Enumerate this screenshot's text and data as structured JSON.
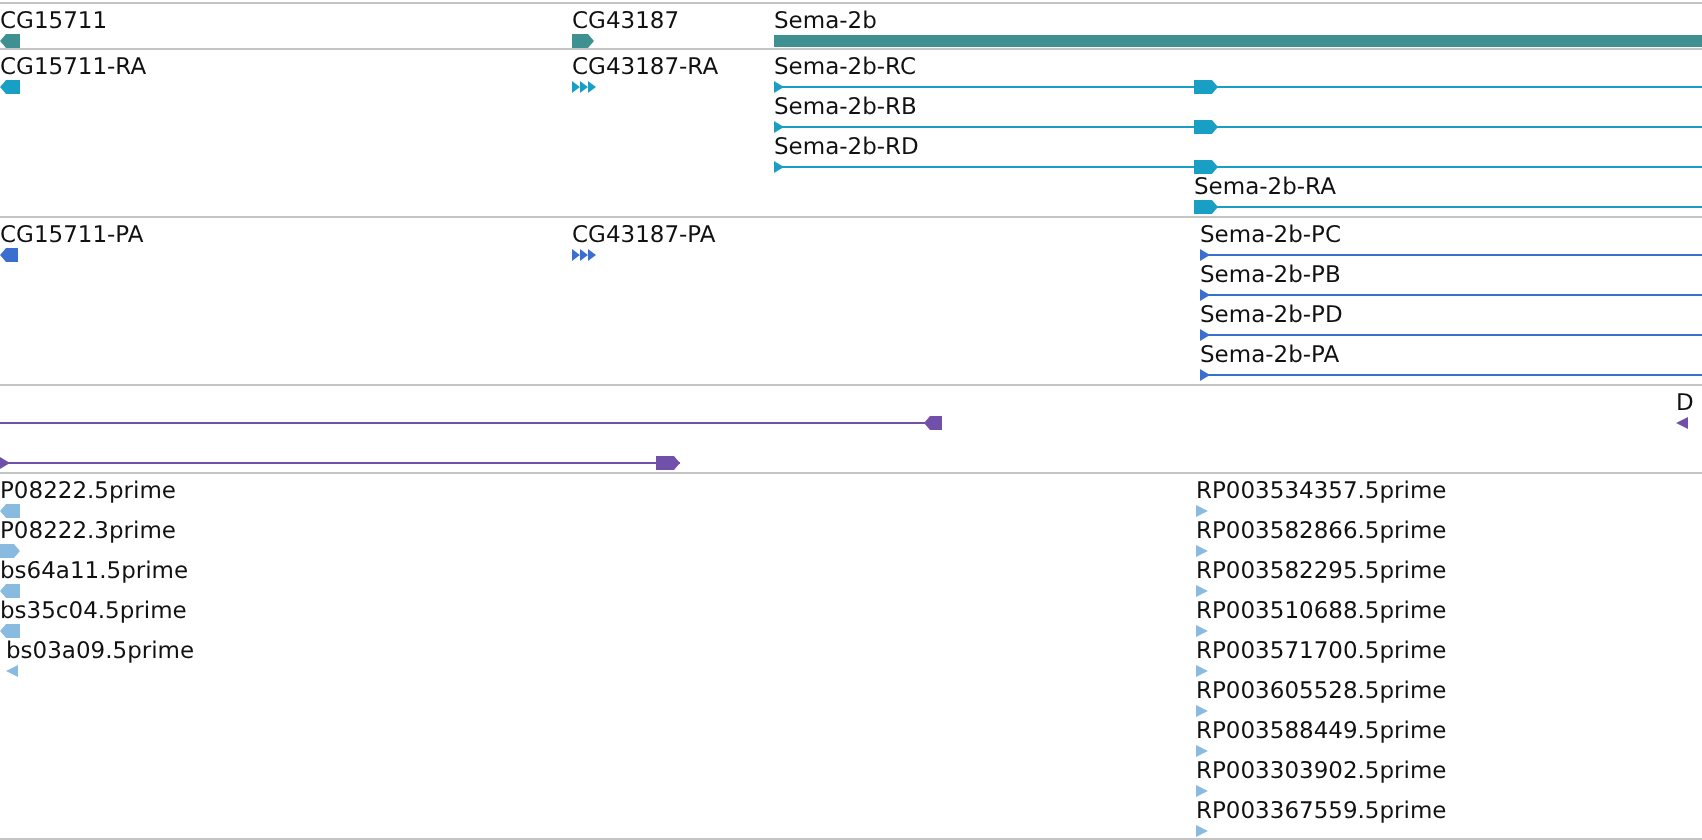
{
  "tracks": [
    {
      "kind": "genes",
      "features": [
        {
          "label": "CG15711",
          "reverse": true
        },
        {
          "label": "CG43187",
          "reverse": false
        },
        {
          "label": "Sema-2b"
        }
      ]
    },
    {
      "kind": "transcripts",
      "features": [
        {
          "label": "CG15711-RA",
          "reverse": true
        },
        {
          "label": "CG43187-RA",
          "reverse": false
        },
        {
          "label": "Sema-2b-RC",
          "reverse": false
        },
        {
          "label": "Sema-2b-RB",
          "reverse": false
        },
        {
          "label": "Sema-2b-RD",
          "reverse": false
        },
        {
          "label": "Sema-2b-RA",
          "reverse": false
        }
      ]
    },
    {
      "kind": "proteins",
      "features": [
        {
          "label": "CG15711-PA",
          "reverse": true
        },
        {
          "label": "CG43187-PA",
          "reverse": false
        },
        {
          "label": "Sema-2b-PC",
          "reverse": false
        },
        {
          "label": "Sema-2b-PB",
          "reverse": false
        },
        {
          "label": "Sema-2b-PD",
          "reverse": false
        },
        {
          "label": "Sema-2b-PA",
          "reverse": false
        }
      ]
    },
    {
      "kind": "other",
      "features": [
        {
          "reverse": true
        },
        {
          "label": "D",
          "reverse": true
        },
        {
          "reverse": false
        }
      ]
    },
    {
      "kind": "ests",
      "features": [
        {
          "label": "P08222.5prime",
          "reverse": true
        },
        {
          "label": "P08222.3prime",
          "reverse": false
        },
        {
          "label": "bs64a11.5prime",
          "reverse": true
        },
        {
          "label": "bs35c04.5prime",
          "reverse": true
        },
        {
          "label": "bs03a09.5prime",
          "reverse": true
        },
        {
          "label": "RP003534357.5prime",
          "reverse": false
        },
        {
          "label": "RP003582866.5prime",
          "reverse": false
        },
        {
          "label": "RP003582295.5prime",
          "reverse": false
        },
        {
          "label": "RP003510688.5prime",
          "reverse": false
        },
        {
          "label": "RP003571700.5prime",
          "reverse": false
        },
        {
          "label": "RP003605528.5prime",
          "reverse": false
        },
        {
          "label": "RP003588449.5prime",
          "reverse": false
        },
        {
          "label": "RP003303902.5prime",
          "reverse": false
        },
        {
          "label": "RP003367559.5prime",
          "reverse": false
        }
      ]
    }
  ]
}
